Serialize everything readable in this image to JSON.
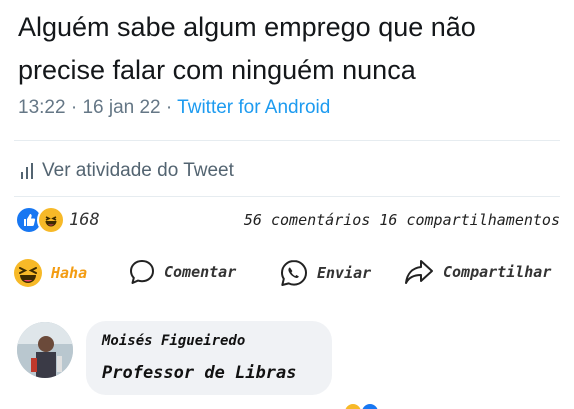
{
  "tweet": {
    "text_line1": "Alguém sabe algum emprego que não",
    "text_line2": "precise falar com ninguém nunca",
    "time": "13:22",
    "date": "16 jan 22",
    "source": "Twitter for Android",
    "activity_label": "Ver atividade do Tweet"
  },
  "facebook": {
    "reaction_count": "168",
    "comments": "56 comentários",
    "shares": "16 compartilhamentos",
    "actions": {
      "haha": "Haha",
      "comment": "Comentar",
      "send": "Enviar",
      "share": "Compartilhar"
    },
    "comment": {
      "author": "Moisés Figueiredo",
      "text": "Professor de Libras"
    }
  },
  "colors": {
    "twitter_blue": "#1d9bf0",
    "facebook_blue": "#1877f2",
    "haha_yellow": "#f7b928",
    "haha_text": "#f39c12"
  }
}
